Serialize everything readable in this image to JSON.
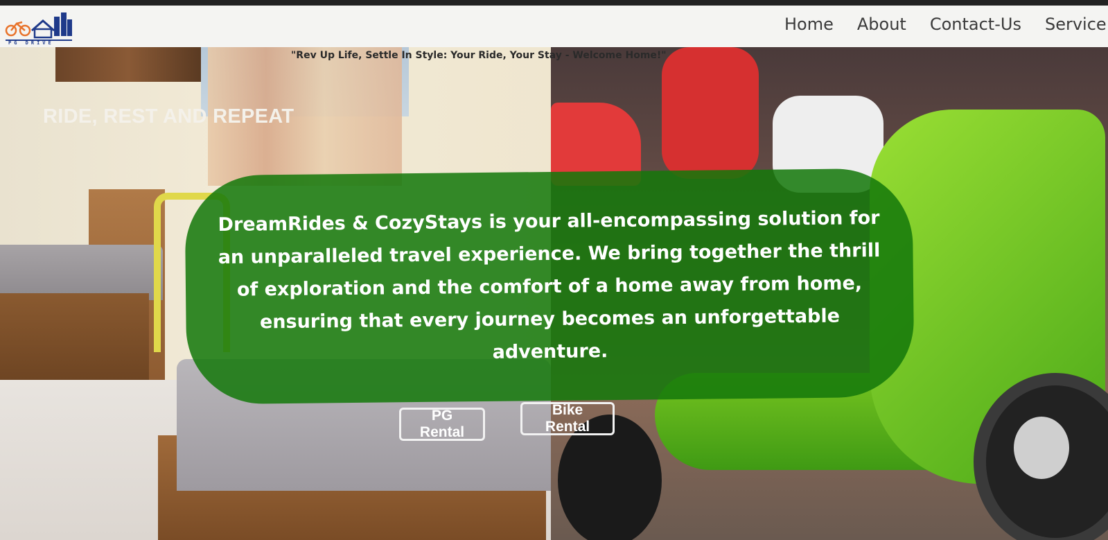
{
  "nav": {
    "logo_text": "PG DRIVE",
    "items": [
      {
        "label": "Home"
      },
      {
        "label": "About"
      },
      {
        "label": "Contact-Us"
      },
      {
        "label": "Service"
      }
    ]
  },
  "hero": {
    "tagline": "\"Rev Up Life, Settle In Style: Your Ride, Your Stay - Welcome Home!\"",
    "title": "RIDE, REST AND REPEAT",
    "intro": "DreamRides & CozyStays is your all-encompassing solution for an unparalleled travel experience. We bring together the thrill of exploration and the comfort of a home away from home, ensuring that every journey becomes an unforgettable adventure.",
    "buttons": {
      "pg": "PG Rental",
      "bike": "Bike Rental"
    }
  },
  "colors": {
    "nav_bg": "#f4f4f2",
    "card_green": "#14780a",
    "logo_orange": "#e8722a",
    "logo_blue": "#1f3a8a"
  }
}
